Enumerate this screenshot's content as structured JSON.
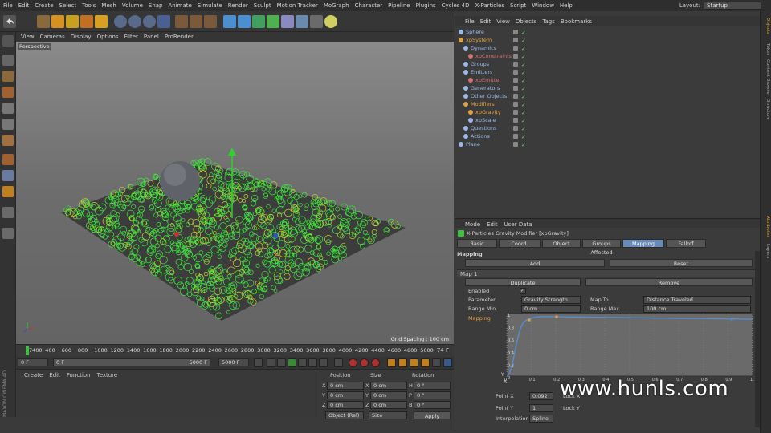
{
  "menu": [
    "File",
    "Edit",
    "Create",
    "Select",
    "Tools",
    "Mesh",
    "Volume",
    "Snap",
    "Animate",
    "Simulate",
    "Render",
    "Sculpt",
    "Motion Tracker",
    "MoGraph",
    "Character",
    "Pipeline",
    "Plugins",
    "Cycles 4D",
    "X-Particles",
    "Script",
    "Window",
    "Help"
  ],
  "layout": {
    "label": "Layout:",
    "value": "Startup"
  },
  "viewport_menu": [
    "View",
    "Cameras",
    "Display",
    "Options",
    "Filter",
    "Panel",
    "ProRender"
  ],
  "viewport": {
    "label": "Perspective",
    "grid_spacing": "Grid Spacing : 100 cm"
  },
  "timeline": {
    "ticks": [
      "7400",
      "400",
      "600",
      "800",
      "1000",
      "1200",
      "1400",
      "1600",
      "1800",
      "2000",
      "2200",
      "2400",
      "2600",
      "2800",
      "3000",
      "3200",
      "3400",
      "3600",
      "3800",
      "4000",
      "4200",
      "4400",
      "4600",
      "4800",
      "5000"
    ],
    "current": "74 F"
  },
  "transport": {
    "start": "0 F",
    "current": "0 F",
    "end_field": "5000 F",
    "end": "5000 F"
  },
  "material_menu": [
    "Create",
    "Edit",
    "Function",
    "Texture"
  ],
  "coords": {
    "headers": [
      "Position",
      "Size",
      "Rotation"
    ],
    "rows": [
      {
        "axis": "X",
        "pos": "0 cm",
        "saxis": "X",
        "size": "0 cm",
        "raxis": "H",
        "rot": "0 °"
      },
      {
        "axis": "Y",
        "pos": "0 cm",
        "saxis": "Y",
        "size": "0 cm",
        "raxis": "P",
        "rot": "0 °"
      },
      {
        "axis": "Z",
        "pos": "0 cm",
        "saxis": "Z",
        "size": "0 cm",
        "raxis": "B",
        "rot": "0 °"
      }
    ],
    "mode": "Object (Rel)",
    "size_mode": "Size",
    "apply": "Apply"
  },
  "objects_menu": [
    "File",
    "Edit",
    "View",
    "Objects",
    "Tags",
    "Bookmarks"
  ],
  "objects": [
    {
      "name": "Sphere",
      "indent": 0,
      "color": "#9ab8e8"
    },
    {
      "name": "xpSystem",
      "indent": 0,
      "color": "#e0a040"
    },
    {
      "name": "Dynamics",
      "indent": 1,
      "color": "#9ab8e8"
    },
    {
      "name": "xpConstraints",
      "indent": 2,
      "color": "#d07070"
    },
    {
      "name": "Groups",
      "indent": 1,
      "color": "#9ab8e8"
    },
    {
      "name": "Emitters",
      "indent": 1,
      "color": "#9ab8e8"
    },
    {
      "name": "xpEmitter",
      "indent": 2,
      "color": "#d07070"
    },
    {
      "name": "Generators",
      "indent": 1,
      "color": "#9ab8e8"
    },
    {
      "name": "Other Objects",
      "indent": 1,
      "color": "#9ab8e8"
    },
    {
      "name": "Modifiers",
      "indent": 1,
      "color": "#e0a040"
    },
    {
      "name": "xpGravity",
      "indent": 2,
      "color": "#e0a040"
    },
    {
      "name": "xpScale",
      "indent": 2,
      "color": "#9ab8e8"
    },
    {
      "name": "Questions",
      "indent": 1,
      "color": "#9ab8e8"
    },
    {
      "name": "Actions",
      "indent": 1,
      "color": "#9ab8e8"
    },
    {
      "name": "Plane",
      "indent": 0,
      "color": "#9ab8e8"
    }
  ],
  "attributes": {
    "menu": [
      "Mode",
      "Edit",
      "User Data"
    ],
    "title": "X-Particles Gravity Modifier [xpGravity]",
    "tabs": [
      "Basic",
      "Coord.",
      "Object",
      "Groups Affected",
      "Mapping",
      "Falloff"
    ],
    "section": "Mapping",
    "add": "Add",
    "reset": "Reset",
    "map_label": "Map 1",
    "duplicate": "Duplicate",
    "remove": "Remove",
    "enabled_label": "Enabled",
    "parameter_label": "Parameter",
    "parameter_value": "Gravity Strength",
    "mapto_label": "Map To",
    "mapto_value": "Distance Traveled",
    "rangemin_label": "Range Min.",
    "rangemin_value": "0 cm",
    "rangemax_label": "Range Max.",
    "rangemax_value": "100 cm",
    "mapping_label": "Mapping",
    "graph_y": [
      "1",
      "0.8",
      "0.6",
      "0.4",
      "0.2",
      "0"
    ],
    "graph_x": [
      "0",
      "0.1",
      "0.2",
      "0.3",
      "0.4",
      "0.5",
      "0.6",
      "0.7",
      "0.8",
      "0.9",
      "1.0"
    ],
    "graph_ylabel": "Y",
    "graph_xlabel": "X",
    "pointx_label": "Point X",
    "pointx_value": "0.092",
    "pointy_label": "Point Y",
    "pointy_value": "1",
    "lockx": "Lock X",
    "locky": "Lock Y",
    "interp_label": "Interpolation",
    "interp_value": "Spline"
  },
  "right_tabs": [
    "Objects",
    "Takes",
    "Content Browser",
    "Structure",
    "Attributes",
    "Layers"
  ],
  "watermark": "www.hunls.com",
  "brand": "MAXON CINEMA 4D"
}
